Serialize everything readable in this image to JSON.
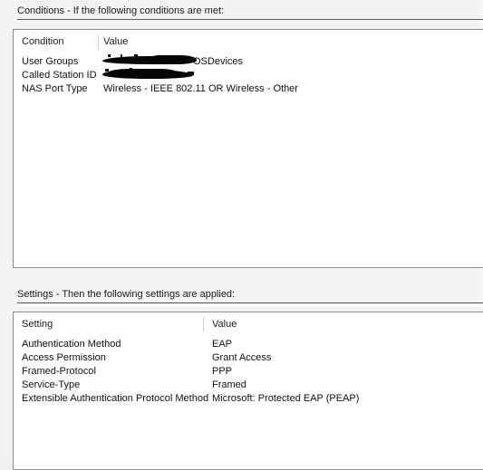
{
  "window": {
    "background_color": "#f0f0f0",
    "panel_background_color": "#ffffff",
    "text_color": "#111111",
    "rule_color": "#5a5a5a"
  },
  "conditions_section": {
    "heading": "Conditions - If the following conditions are met:",
    "table": {
      "columns": [
        "Condition",
        "Value"
      ],
      "rows": [
        {
          "name": "User Groups",
          "value": "OSDevices",
          "redacted": true
        },
        {
          "name": "Called Station ID",
          "value": "",
          "redacted": true
        },
        {
          "name": "NAS Port Type",
          "value": "Wireless - IEEE 802.11 OR Wireless - Other",
          "redacted": false
        }
      ]
    }
  },
  "settings_section": {
    "heading": "Settings - Then the following settings are applied:",
    "table": {
      "columns": [
        "Setting",
        "Value"
      ],
      "rows": [
        {
          "name": "Authentication Method",
          "value": "EAP"
        },
        {
          "name": "Access Permission",
          "value": "Grant Access"
        },
        {
          "name": "Framed-Protocol",
          "value": "PPP"
        },
        {
          "name": "Service-Type",
          "value": "Framed"
        },
        {
          "name": "Extensible Authentication Protocol Method",
          "value": "Microsoft: Protected EAP (PEAP)"
        }
      ]
    }
  }
}
